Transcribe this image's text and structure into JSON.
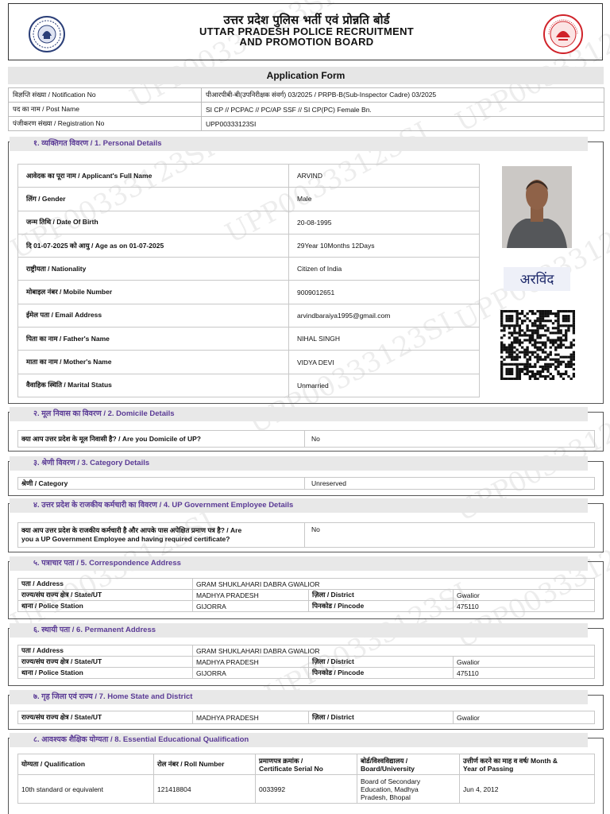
{
  "header": {
    "title_hindi": "उत्तर प्रदेश पुलिस भर्ती एवं प्रोन्नति बोर्ड",
    "title_english_line1": "UTTAR PRADESH POLICE RECRUITMENT",
    "title_english_line2": "AND PROMOTION BOARD",
    "left_logo_icon": "up-police-emblem-icon",
    "right_logo_icon": "up-government-seal-icon"
  },
  "form_title": "Application Form",
  "watermark": "UPP00333123SI",
  "notice": [
    {
      "label": "विज्ञप्ति संख्या / Notification No",
      "value": "पीआरपीबी-बी(उपनिरीक्षक संवर्ग) 03/2025 / PRPB-B(Sub-Inspector Cadre) 03/2025"
    },
    {
      "label": "पद का नाम / Post Name",
      "value": "SI CP // PCPAC // PC/AP SSF // SI CP(PC) Female Bn."
    },
    {
      "label": "पंजीकरण संख्या / Registration No",
      "value": "UPP00333123SI"
    }
  ],
  "sections": {
    "personal": "१. व्यक्तिगत विवरण / 1. Personal Details",
    "domicile": "२. मूल निवास का विवरण / 2. Domicile Details",
    "category": "३. श्रेणी विवरण / 3. Category Details",
    "govt": "४. उत्तर प्रदेश के राजकीय कर्मचारी का विवरण / 4. UP Government Employee Details",
    "correspondence": "५. पत्राचार पता / 5. Correspondence Address",
    "permanent": "६. स्थायी पता / 6. Permanent Address",
    "home": "७. गृह जिला एवं राज्य / 7. Home State and District",
    "education": "८. आवश्यक शैक्षिक योग्यता / 8. Essential Educational Qualification"
  },
  "personal": [
    {
      "label": "आवेदक का पूरा नाम / Applicant's Full Name",
      "value": "ARVIND"
    },
    {
      "label": "लिंग / Gender",
      "value": "Male"
    },
    {
      "label": "जन्म तिथि / Date Of Birth",
      "value": "20-08-1995"
    },
    {
      "label": "दि 01-07-2025 को आयु / Age as on 01-07-2025",
      "value": "29Year 10Months 12Days"
    },
    {
      "label": "राष्ट्रीयता / Nationality",
      "value": "Citizen of India"
    },
    {
      "label": "मोबाइल नंबर / Mobile Number",
      "value": "9009012651"
    },
    {
      "label": "ईमेल पता / Email Address",
      "value": "arvindbaraiya1995@gmail.com"
    },
    {
      "label": "पिता का नाम / Father's Name",
      "value": "NIHAL SINGH"
    },
    {
      "label": "माता का नाम / Mother's Name",
      "value": "VIDYA DEVI"
    },
    {
      "label": "वैवाहिक स्थिति / Marital Status",
      "value": "Unmarried"
    }
  ],
  "signature_text": "अरविंद",
  "domicile": {
    "label": "क्या आप उत्तर प्रदेश के मूल निवासी है? / Are you Domicile of UP?",
    "value": "No"
  },
  "category": {
    "label": "श्रेणी / Category",
    "value": "Unreserved"
  },
  "govt": {
    "label_line1": "क्या आप उत्तर प्रदेश के राजकीय कर्मचारी है और आपके पास अपेक्षित प्रमाण पत्र है? / Are",
    "label_line2": "you a UP Government Employee and having required certificate?",
    "value": "No"
  },
  "address_labels": {
    "address": "पता / Address",
    "state": "राज्य/संघ राज्य क्षेत्र / State/UT",
    "district": "ज़िला / District",
    "police": "थाना / Police Station",
    "pincode": "पिनकोड / Pincode"
  },
  "correspondence": {
    "address": "GRAM SHUKLAHARI DABRA GWALIOR",
    "state": "MADHYA PRADESH",
    "district": "Gwalior",
    "police": "GIJORRA",
    "pincode": "475110"
  },
  "permanent": {
    "address": "GRAM SHUKLAHARI DABRA GWALIOR",
    "state": "MADHYA PRADESH",
    "district": "Gwalior",
    "police": "GIJORRA",
    "pincode": "475110"
  },
  "home": {
    "state": "MADHYA PRADESH",
    "district": "Gwalior"
  },
  "education": {
    "headers": {
      "qualification": "योग्यता / Qualification",
      "roll": "रोल नंबर / Roll Number",
      "cert_line1": "प्रमाणपत्र क्रमांक /",
      "cert_line2": "Certificate Serial No",
      "board_line1": "बोर्ड/विश्वविद्यालय /",
      "board_line2": "Board/University",
      "year_line1": "उत्तीर्ण करने का माह व वर्ष/ Month &",
      "year_line2": "Year of Passing"
    },
    "row": {
      "qualification": "10th standard or equivalent",
      "roll": "121418804",
      "cert": "0033992",
      "board_line1": "Board of Secondary",
      "board_line2": "Education, Madhya",
      "board_line3": "Pradesh, Bhopal",
      "year": "Jun 4, 2012"
    }
  }
}
